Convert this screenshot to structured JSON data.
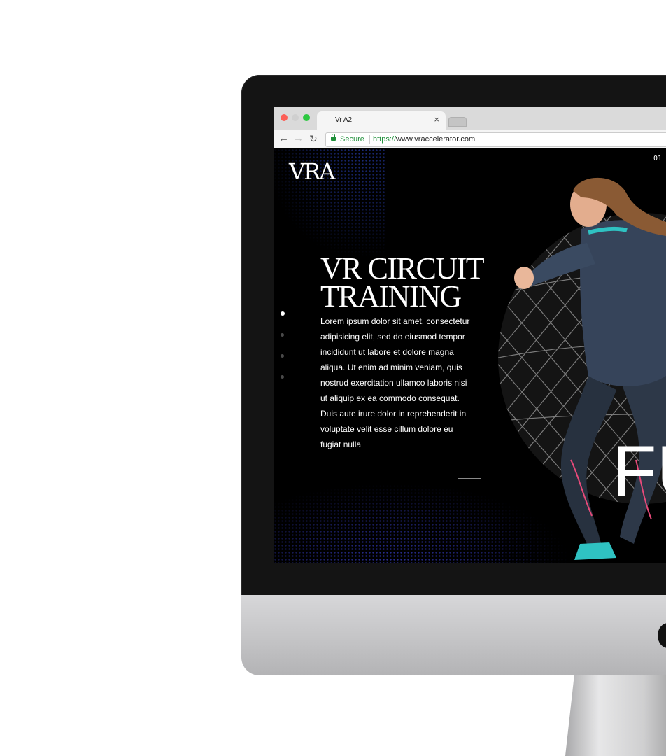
{
  "browser": {
    "tab_title": "Vr A2",
    "tab_close": "×",
    "secure_label": "Secure",
    "url_scheme": "https://",
    "url_host": "www.vraccelerator.com"
  },
  "page": {
    "logo": "VRA",
    "slide_number": "01",
    "heading_line1": "VR CIRCUIT",
    "heading_line2": "TRAINING",
    "body": "Lorem ipsum dolor sit amet, consectetur adipisicing elit, sed do eiusmod tempor incididunt ut labore et dolore magna aliqua. Ut enim ad minim veniam, quis nostrud exercitation ullamco laboris nisi ut aliquip ex ea commodo consequat. Duis aute irure dolor in reprehenderit in voluptate velit esse cillum dolore eu fugiat nulla",
    "big_text": "FU",
    "pager_count": 4,
    "pager_active": 1
  },
  "colors": {
    "accent_blue": "#1b2a7a",
    "secure_green": "#1f8f3a",
    "jacket": "#36445a",
    "teal": "#2fc2c2",
    "leggings_pink": "#e84a7a"
  },
  "icons": [
    "back-arrow-icon",
    "forward-arrow-icon",
    "reload-icon",
    "lock-icon",
    "close-icon",
    "crosshair-icon"
  ]
}
